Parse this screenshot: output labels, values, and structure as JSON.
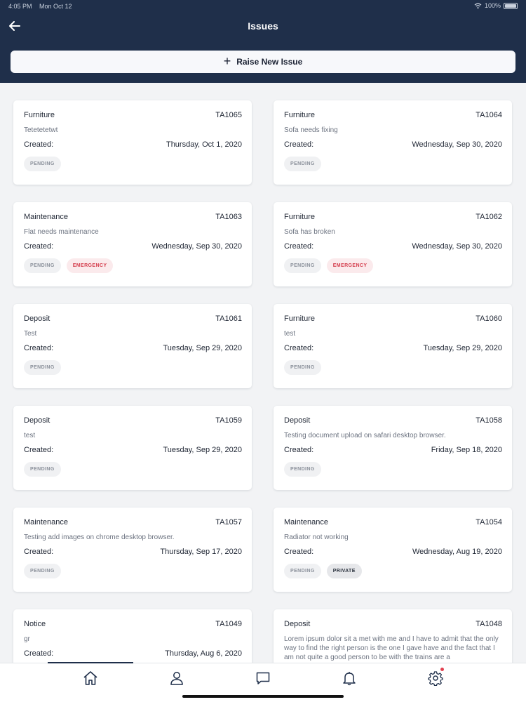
{
  "status_bar": {
    "time": "4:05 PM",
    "date": "Mon Oct 12",
    "battery": "100%"
  },
  "header": {
    "title": "Issues",
    "raise_button_label": "Raise New Issue"
  },
  "issues": [
    {
      "category": "Furniture",
      "id": "TA1065",
      "description": "Tetetetetwt",
      "created_label": "Created:",
      "created_date": "Thursday, Oct 1, 2020",
      "badges": [
        {
          "label": "PENDING",
          "type": "pending"
        }
      ]
    },
    {
      "category": "Furniture",
      "id": "TA1064",
      "description": "Sofa needs fixing",
      "created_label": "Created:",
      "created_date": "Wednesday, Sep 30, 2020",
      "badges": [
        {
          "label": "PENDING",
          "type": "pending"
        }
      ]
    },
    {
      "category": "Maintenance",
      "id": "TA1063",
      "description": "Flat needs maintenance",
      "created_label": "Created:",
      "created_date": "Wednesday, Sep 30, 2020",
      "badges": [
        {
          "label": "PENDING",
          "type": "pending"
        },
        {
          "label": "EMERGENCY",
          "type": "emergency"
        }
      ]
    },
    {
      "category": "Furniture",
      "id": "TA1062",
      "description": "Sofa has broken",
      "created_label": "Created:",
      "created_date": "Wednesday, Sep 30, 2020",
      "badges": [
        {
          "label": "PENDING",
          "type": "pending"
        },
        {
          "label": "EMERGENCY",
          "type": "emergency"
        }
      ]
    },
    {
      "category": "Deposit",
      "id": "TA1061",
      "description": "Test",
      "created_label": "Created:",
      "created_date": "Tuesday, Sep 29, 2020",
      "badges": [
        {
          "label": "PENDING",
          "type": "pending"
        }
      ]
    },
    {
      "category": "Furniture",
      "id": "TA1060",
      "description": "test",
      "created_label": "Created:",
      "created_date": "Tuesday, Sep 29, 2020",
      "badges": [
        {
          "label": "PENDING",
          "type": "pending"
        }
      ]
    },
    {
      "category": "Deposit",
      "id": "TA1059",
      "description": "test",
      "created_label": "Created:",
      "created_date": "Tuesday, Sep 29, 2020",
      "badges": [
        {
          "label": "PENDING",
          "type": "pending"
        }
      ]
    },
    {
      "category": "Deposit",
      "id": "TA1058",
      "description": "Testing document upload on safari desktop browser.",
      "created_label": "Created:",
      "created_date": "Friday, Sep 18, 2020",
      "badges": [
        {
          "label": "PENDING",
          "type": "pending"
        }
      ]
    },
    {
      "category": "Maintenance",
      "id": "TA1057",
      "description": "Testing add images on chrome desktop browser.",
      "created_label": "Created:",
      "created_date": "Thursday, Sep 17, 2020",
      "badges": [
        {
          "label": "PENDING",
          "type": "pending"
        }
      ]
    },
    {
      "category": "Maintenance",
      "id": "TA1054",
      "description": "Radiator not working",
      "created_label": "Created:",
      "created_date": "Wednesday, Aug 19, 2020",
      "badges": [
        {
          "label": "PENDING",
          "type": "pending"
        },
        {
          "label": "PRIVATE",
          "type": "private"
        }
      ]
    },
    {
      "category": "Notice",
      "id": "TA1049",
      "description": "gr",
      "created_label": "Created:",
      "created_date": "Thursday, Aug 6, 2020",
      "badges": []
    },
    {
      "category": "Deposit",
      "id": "TA1048",
      "description": "Lorem ipsum dolor sit a met with me and I have to admit that the only way to find the right person is the one I gave have and the fact that I am not quite a good person to be with the trains are a",
      "created_label": "",
      "created_date": "",
      "badges": []
    }
  ],
  "tabbar": {
    "tabs": [
      {
        "name": "home",
        "icon": "home-icon",
        "active": true
      },
      {
        "name": "profile",
        "icon": "user-icon",
        "active": false
      },
      {
        "name": "messages",
        "icon": "chat-icon",
        "active": false
      },
      {
        "name": "notifications",
        "icon": "bell-icon",
        "active": false
      },
      {
        "name": "settings",
        "icon": "gear-icon",
        "active": false,
        "has_badge": true
      }
    ]
  },
  "colors": {
    "header_bg": "#1f2f4a",
    "emergency": "#d43b4b",
    "notify_dot": "#e2404f"
  }
}
